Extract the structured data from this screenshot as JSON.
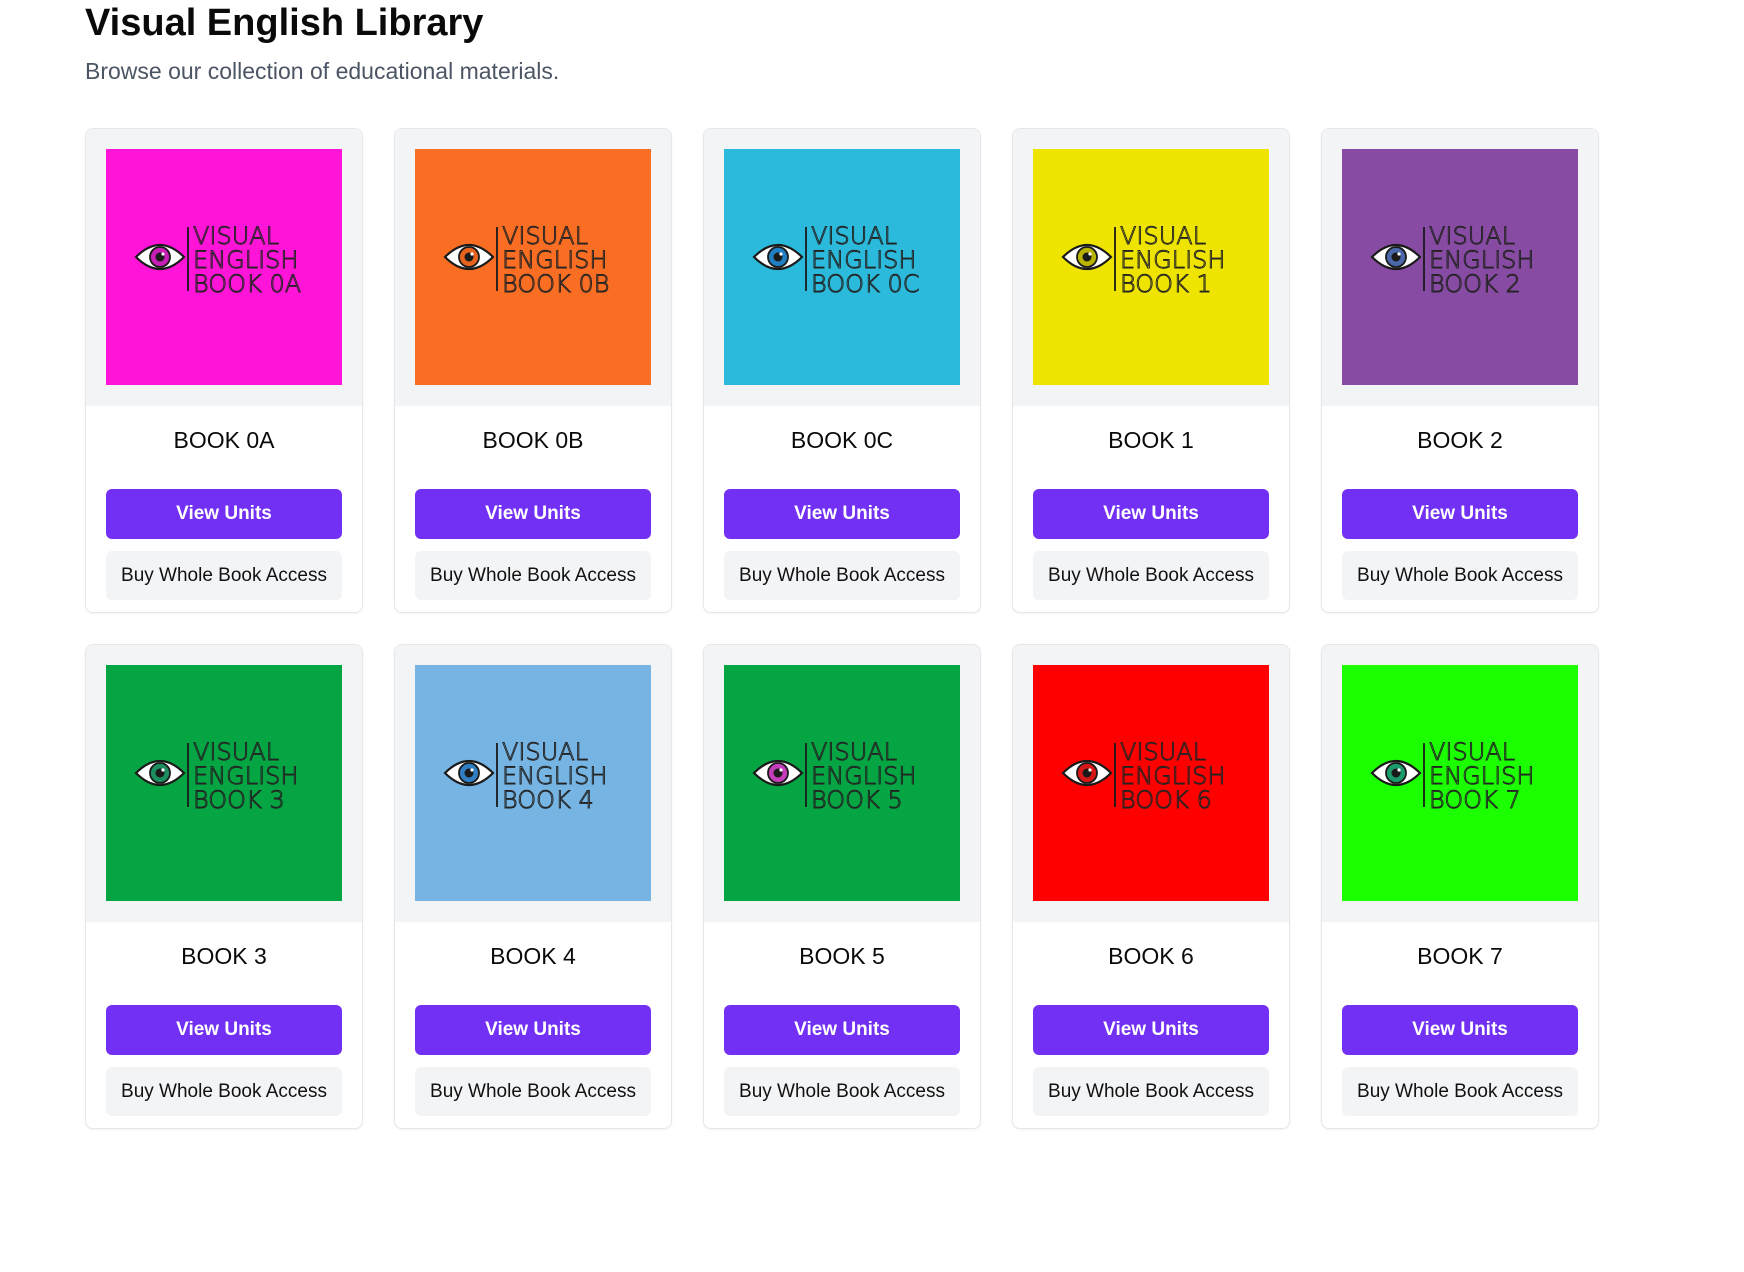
{
  "header": {
    "title": "Visual English Library",
    "subtitle": "Browse our collection of educational materials."
  },
  "buttons": {
    "view_label": "View Units",
    "buy_label": "Buy Whole Book Access"
  },
  "books": [
    {
      "title": "BOOK 0A",
      "cover_line1": "VISUAL",
      "cover_line2": "ENGLISH",
      "cover_line3": "BOOK 0A",
      "bg": "#ff14d8",
      "iris": "#c71fb5"
    },
    {
      "title": "BOOK 0B",
      "cover_line1": "VISUAL",
      "cover_line2": "ENGLISH",
      "cover_line3": "BOOK 0B",
      "bg": "#f96e23",
      "iris": "#e5631c"
    },
    {
      "title": "BOOK 0C",
      "cover_line1": "VISUAL",
      "cover_line2": "ENGLISH",
      "cover_line3": "BOOK 0C",
      "bg": "#2bbadb",
      "iris": "#1f7fc0"
    },
    {
      "title": "BOOK 1",
      "cover_line1": "VISUAL",
      "cover_line2": "ENGLISH",
      "cover_line3": "BOOK 1",
      "bg": "#efe400",
      "iris": "#b8b300"
    },
    {
      "title": "BOOK 2",
      "cover_line1": "VISUAL",
      "cover_line2": "ENGLISH",
      "cover_line3": "BOOK 2",
      "bg": "#884ba3",
      "iris": "#4a68a8"
    },
    {
      "title": "BOOK 3",
      "cover_line1": "VISUAL",
      "cover_line2": "ENGLISH",
      "cover_line3": "BOOK 3",
      "bg": "#05a543",
      "iris": "#1c8e5f"
    },
    {
      "title": "BOOK 4",
      "cover_line1": "VISUAL",
      "cover_line2": "ENGLISH",
      "cover_line3": "BOOK 4",
      "bg": "#75b4e3",
      "iris": "#2f7fc2"
    },
    {
      "title": "BOOK 5",
      "cover_line1": "VISUAL",
      "cover_line2": "ENGLISH",
      "cover_line3": "BOOK 5",
      "bg": "#05a543",
      "iris": "#c43dbb"
    },
    {
      "title": "BOOK 6",
      "cover_line1": "VISUAL",
      "cover_line2": "ENGLISH",
      "cover_line3": "BOOK 6",
      "bg": "#ff0000",
      "iris": "#d81818"
    },
    {
      "title": "BOOK 7",
      "cover_line1": "VISUAL",
      "cover_line2": "ENGLISH",
      "cover_line3": "BOOK 7",
      "bg": "#1bff00",
      "iris": "#1a9c6a"
    }
  ]
}
